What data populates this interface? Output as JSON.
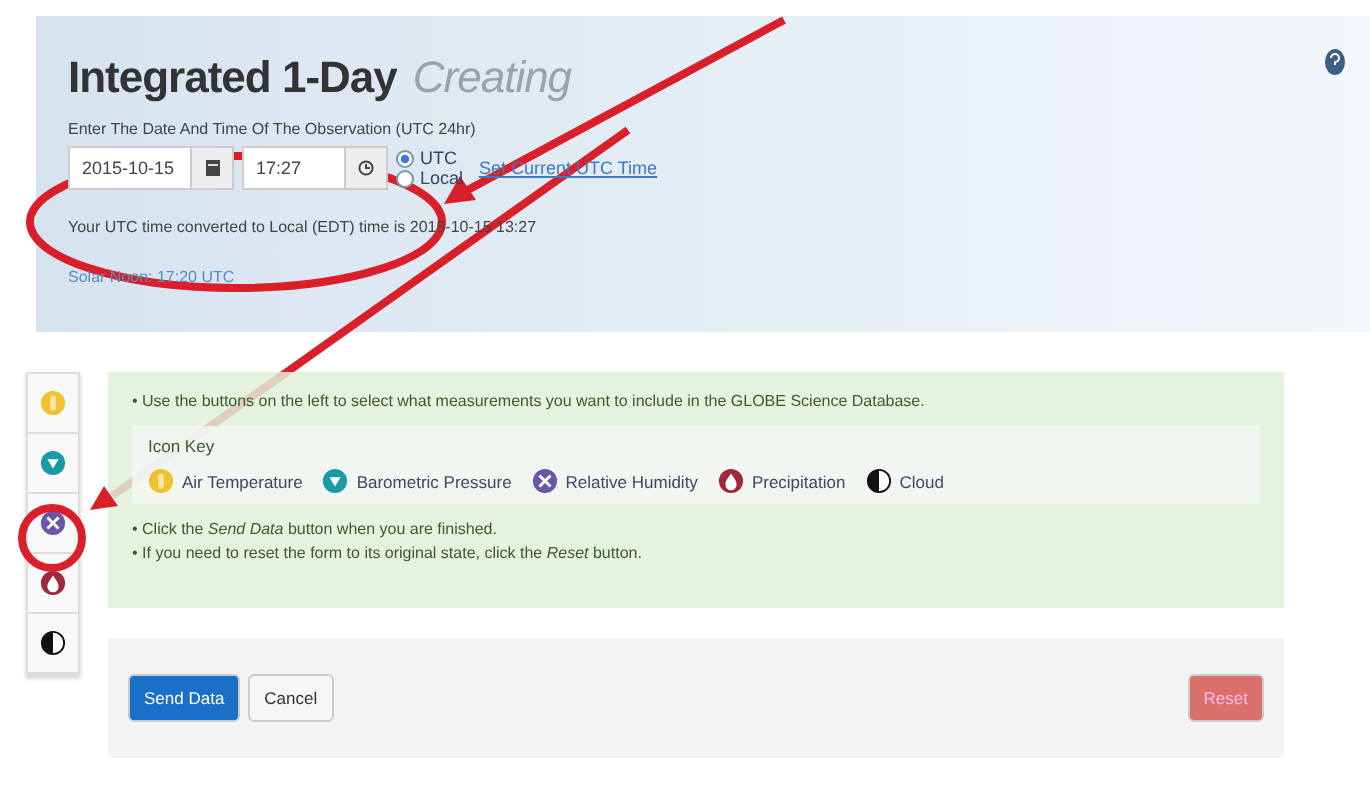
{
  "header": {
    "title": "Integrated 1-Day",
    "status": "Creating",
    "prompt": "Enter The Date And Time Of The Observation (UTC 24hr)",
    "date": "2015-10-15",
    "time": "17:27",
    "zones": [
      {
        "label": "UTC",
        "selected": true
      },
      {
        "label": "Local",
        "selected": false
      }
    ],
    "link": "Set Current UTC Time",
    "converted": "Your UTC time converted to Local (EDT) time is 2015-10-15 13:27",
    "solar_noon": "Solar Noon: 17:20 UTC"
  },
  "measure_buttons": [
    {
      "kind": "temperature"
    },
    {
      "kind": "pressure"
    },
    {
      "kind": "humidity"
    },
    {
      "kind": "precipitation"
    },
    {
      "kind": "cloud"
    }
  ],
  "info": {
    "intro": "• Use the buttons on the left to select what measurements you want to include in the GLOBE Science Database.",
    "key_title": "Icon Key",
    "legend": [
      {
        "kind": "temperature",
        "label": "Air Temperature"
      },
      {
        "kind": "pressure",
        "label": "Barometric Pressure"
      },
      {
        "kind": "humidity",
        "label": "Relative Humidity"
      },
      {
        "kind": "precipitation",
        "label": "Precipitation"
      },
      {
        "kind": "cloud",
        "label": "Cloud"
      }
    ],
    "notes": [
      "• Click the *Send Data* button when you are finished.",
      "• If you need to reset the form to its original state, click the *Reset* button."
    ]
  },
  "buttons": {
    "send": "Send Data",
    "cancel": "Cancel",
    "reset": "Reset"
  }
}
